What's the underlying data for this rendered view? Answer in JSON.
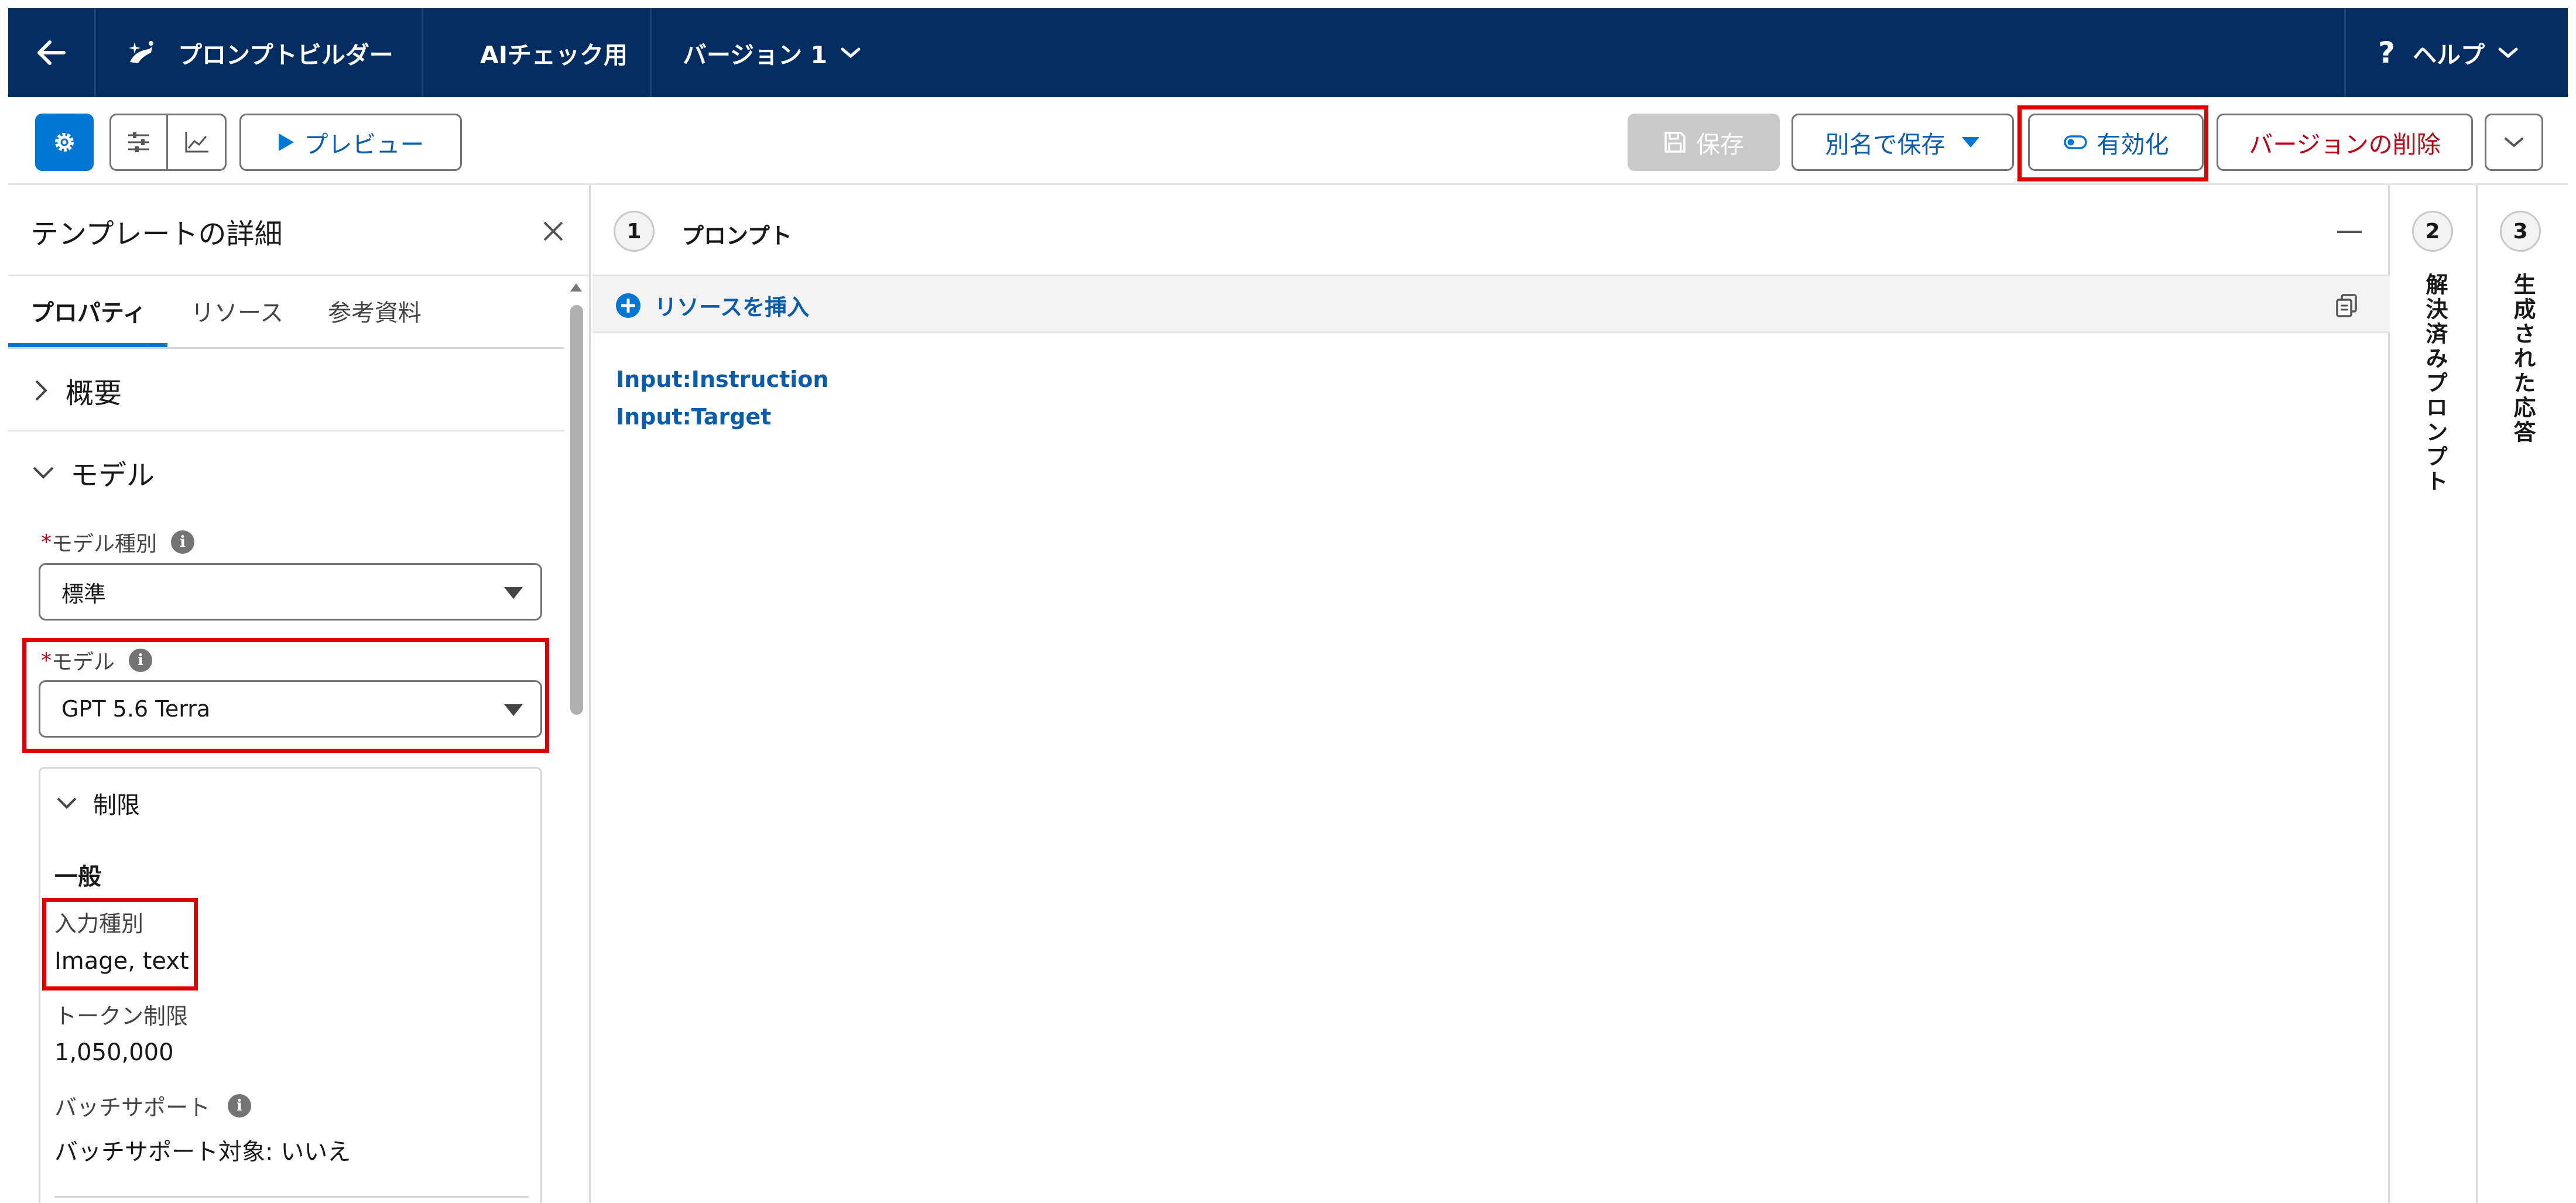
{
  "nav": {
    "app_name": "プロンプトビルダー",
    "template_name": "AIチェック用",
    "version_label": "バージョン 1",
    "help_label": "ヘルプ"
  },
  "toolbar": {
    "preview_label": "プレビュー",
    "save_label": "保存",
    "save_as_label": "別名で保存",
    "activate_label": "有効化",
    "delete_version_label": "バージョンの削除"
  },
  "left_panel": {
    "title": "テンプレートの詳細",
    "tabs": [
      {
        "label": "プロパティ",
        "active": true
      },
      {
        "label": "リソース",
        "active": false
      },
      {
        "label": "参考資料",
        "active": false
      }
    ],
    "overview_label": "概要",
    "model_section_label": "モデル",
    "model_type": {
      "required_mark": "*",
      "label": "モデル種別",
      "value": "標準"
    },
    "model": {
      "required_mark": "*",
      "label": "モデル",
      "value": "GPT 5.6 Terra"
    },
    "limits": {
      "label": "制限",
      "general_heading": "一般",
      "input_type_label": "入力種別",
      "input_type_value": "Image, text",
      "token_limit_label": "トークン制限",
      "token_limit_value": "1,050,000",
      "batch_support_label": "バッチサポート",
      "batch_support_value": "バッチサポート対象: いいえ"
    }
  },
  "prompt_panel": {
    "step_number": "1",
    "title": "プロンプト",
    "insert_resource_label": "リソースを挿入",
    "lines": [
      "Input:Instruction",
      "Input:Target"
    ]
  },
  "side_panels": [
    {
      "step_number": "2",
      "label": "解決済みプロンプト"
    },
    {
      "step_number": "3",
      "label": "生成された応答"
    }
  ],
  "colors": {
    "nav_bg": "#032d60",
    "brand_blue": "#0176d3",
    "link_blue": "#0b5cab",
    "destructive_red": "#ba0517",
    "highlight_red": "#e00000"
  },
  "icons": {
    "back": "arrow-left-icon",
    "app": "sparkle-hand-icon",
    "help": "question-icon",
    "settings": "gear-icon",
    "config": "sliders-icon",
    "chart": "line-chart-icon",
    "play": "play-icon",
    "save": "floppy-disk-icon",
    "activate": "toggle-icon",
    "insert": "plus-circle-icon",
    "copy": "copy-icon",
    "close": "close-icon"
  }
}
